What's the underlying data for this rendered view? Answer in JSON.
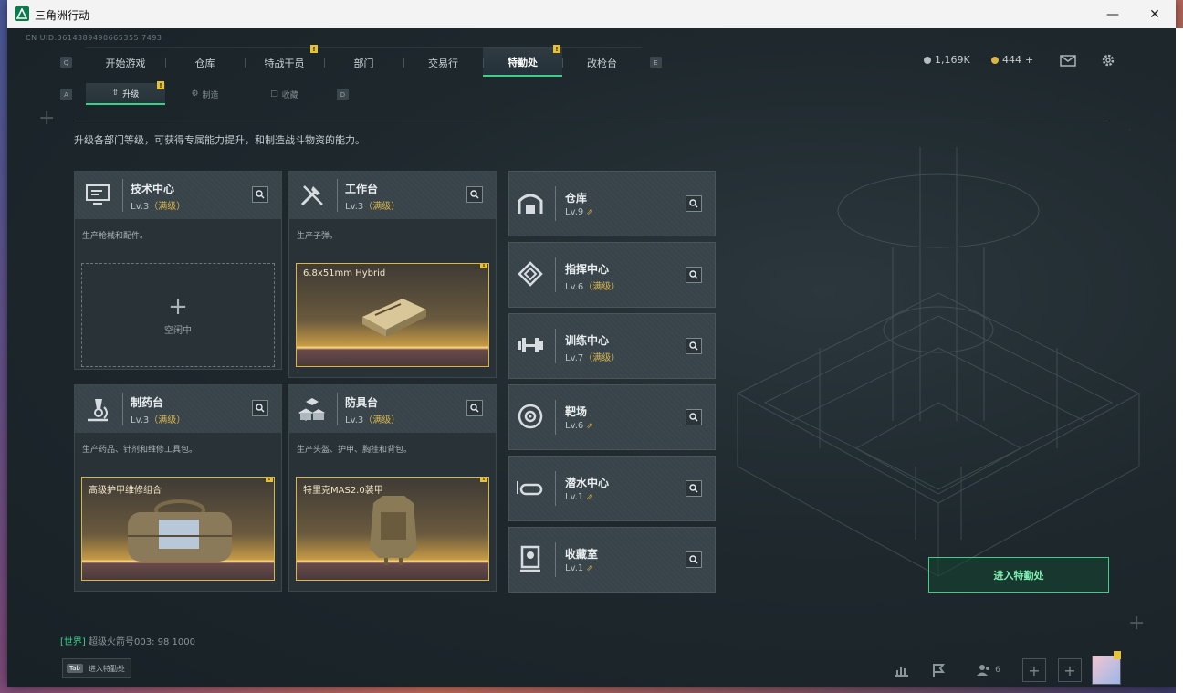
{
  "window": {
    "title": "三角洲行动"
  },
  "uid": "CN UID:3614389490665355 7493",
  "nav": {
    "left_key": "Q",
    "right_key": "E",
    "items": [
      {
        "label": "开始游戏"
      },
      {
        "label": "仓库"
      },
      {
        "label": "特战干员",
        "badge": "!"
      },
      {
        "label": "部门"
      },
      {
        "label": "交易行"
      },
      {
        "label": "特勤处",
        "badge": "!",
        "active": true
      },
      {
        "label": "改枪台"
      }
    ]
  },
  "currency": {
    "coins": "1,169K",
    "gold": "444"
  },
  "subnav": {
    "left_key": "A",
    "right_key": "D",
    "items": [
      {
        "label": "升级",
        "badge": "!",
        "active": true
      },
      {
        "label": "制造"
      },
      {
        "label": "收藏"
      }
    ]
  },
  "description": "升级各部门等级，可获得专属能力提升，和制造战斗物资的能力。",
  "facilities": [
    {
      "name": "技术中心",
      "level": "Lv.3",
      "status": "（满级）",
      "desc": "生产枪械和配件。",
      "slot": {
        "empty": true,
        "label": "空闲中"
      }
    },
    {
      "name": "工作台",
      "level": "Lv.3",
      "status": "（满级）",
      "desc": "生产子弹。",
      "slot": {
        "empty": false,
        "item": "6.8x51mm Hybrid",
        "badge": "!"
      }
    },
    {
      "name": "制药台",
      "level": "Lv.3",
      "status": "（满级）",
      "desc": "生产药品、针剂和维修工具包。",
      "slot": {
        "empty": false,
        "item": "高级护甲维修组合",
        "badge": "!"
      }
    },
    {
      "name": "防具台",
      "level": "Lv.3",
      "status": "（满级）",
      "desc": "生产头盔、护甲、胸挂和背包。",
      "slot": {
        "empty": false,
        "item": "特里克MAS2.0装甲",
        "badge": "!"
      }
    }
  ],
  "side_facilities": [
    {
      "name": "仓库",
      "level": "Lv.9",
      "status": "",
      "upgradable": true
    },
    {
      "name": "指挥中心",
      "level": "Lv.6",
      "status": "（满级）",
      "upgradable": false
    },
    {
      "name": "训练中心",
      "level": "Lv.7",
      "status": "（满级）",
      "upgradable": false
    },
    {
      "name": "靶场",
      "level": "Lv.6",
      "status": "",
      "upgradable": true
    },
    {
      "name": "潜水中心",
      "level": "Lv.1",
      "status": "",
      "upgradable": true
    },
    {
      "name": "收藏室",
      "level": "Lv.1",
      "status": "",
      "upgradable": true
    }
  ],
  "enter_button": "进入特勤处",
  "chat": {
    "channel": "[世界]",
    "text": "超级火箭号003: 98 1000"
  },
  "tab_hint": {
    "key": "Tab",
    "label": "进入特勤处"
  },
  "friends_count": "6",
  "colors": {
    "accent": "#3bd08a",
    "gold": "#d9b64a",
    "badge": "#e6c23a"
  }
}
